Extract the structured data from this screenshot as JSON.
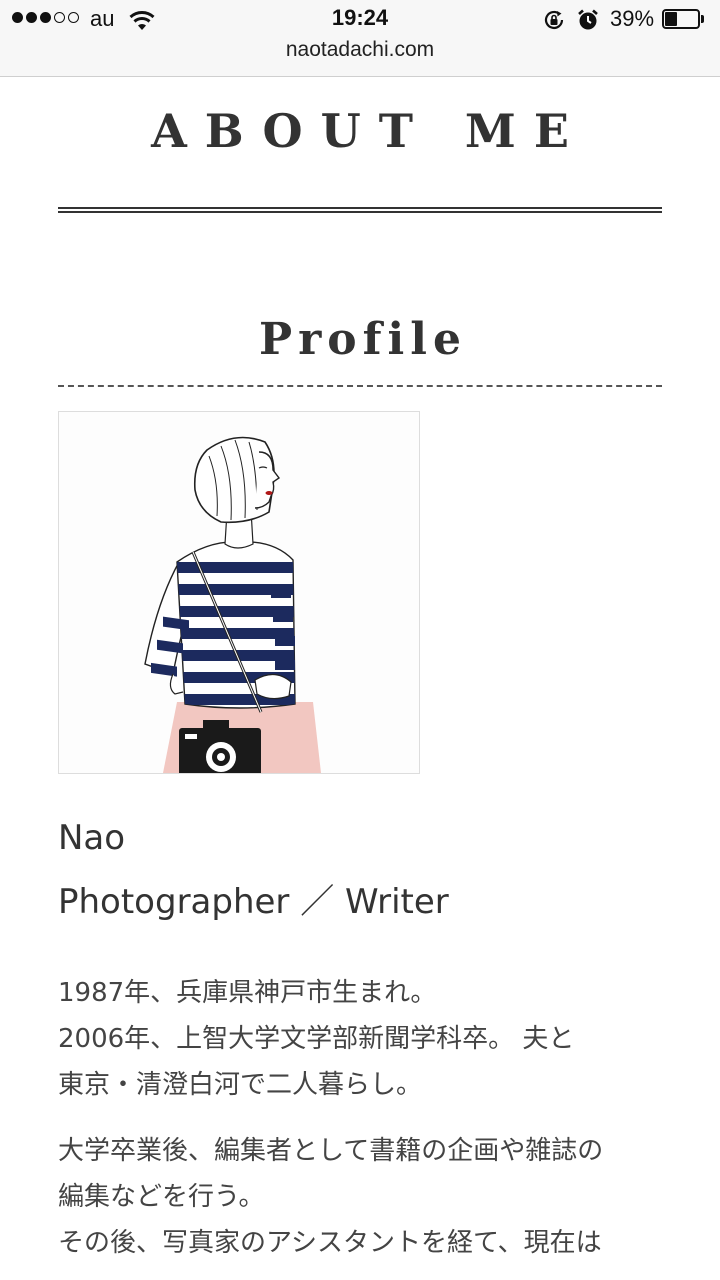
{
  "status_bar": {
    "carrier": "au",
    "signal_bars_filled": 3,
    "signal_bars_total": 5,
    "time": "19:24",
    "battery_percent_label": "39%",
    "battery_level": 0.39,
    "icons": [
      "wifi-icon",
      "lock-rotation-icon",
      "alarm-icon",
      "battery-icon"
    ]
  },
  "browser": {
    "url": "naotadachi.com"
  },
  "page": {
    "title": "ABOUT ME",
    "section_heading": "Profile",
    "avatar": {
      "description_icon": "illustration-girl-with-camera",
      "colors": {
        "stripe": "#1c2a5e",
        "skirt": "#f2c7c1",
        "lips": "#b01818"
      }
    },
    "profile": {
      "name": "Nao",
      "role": "Photographer ／ Writer"
    },
    "bio": {
      "paragraph_1": [
        "1987年、兵庫県神戸市生まれ。",
        "2006年、上智大学文学部新聞学科卒。 夫と",
        "東京・清澄白河で二人暮らし。"
      ],
      "paragraph_2": [
        "大学卒業後、編集者として書籍の企画や雑誌の",
        "編集などを行う。",
        "その後、写真家のアシスタントを経て、現在は"
      ]
    }
  }
}
